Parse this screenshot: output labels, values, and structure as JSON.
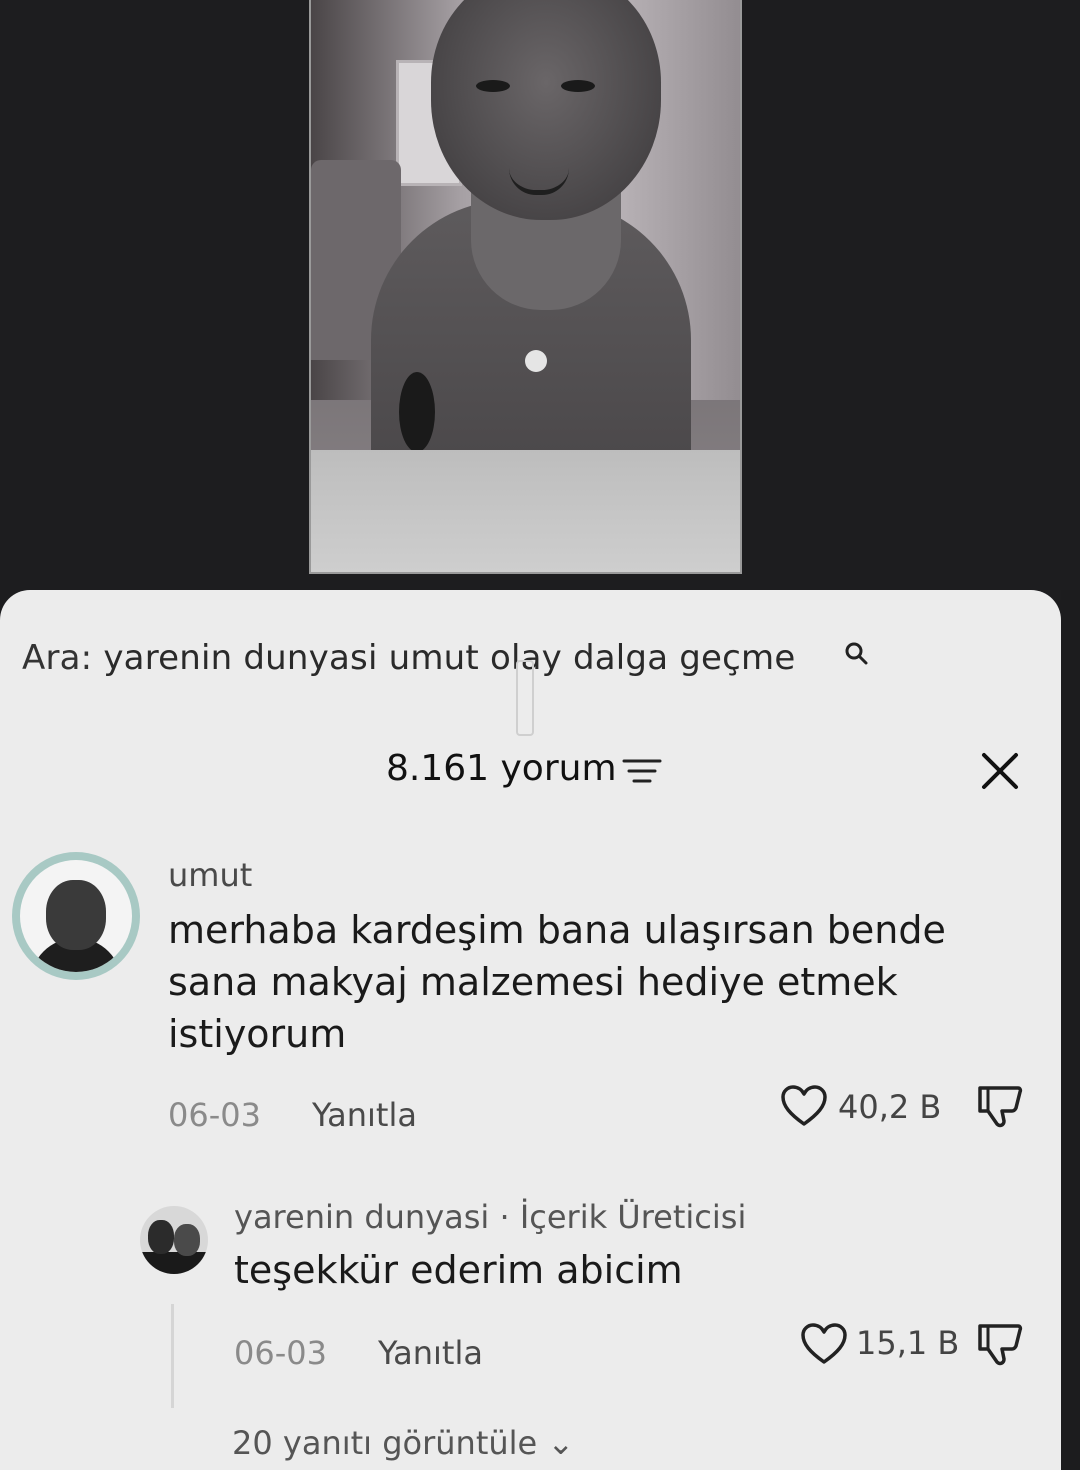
{
  "search": {
    "label": "Ara:",
    "query": "yarenin dunyasi umut olay dalga geçme"
  },
  "comments_header": {
    "count_label": "8.161 yorum"
  },
  "comment": {
    "username": "umut",
    "text": "merhaba kardeşim bana ulaşırsan bende sana makyaj malzemesi hediye etmek istiyorum",
    "date": "06-03",
    "reply_label": "Yanıtla",
    "likes": "40,2 B"
  },
  "reply": {
    "username": "yarenin dunyasi · İçerik Üreticisi",
    "text": "teşekkür ederim abicim",
    "date": "06-03",
    "reply_label": "Yanıtla",
    "likes": "15,1 B"
  },
  "view_replies": "20 yanıtı görüntüle ⌄",
  "icons": {
    "search": "search-icon",
    "filter": "filter-icon",
    "close": "close-icon",
    "like": "heart-icon",
    "dislike": "dislike-icon"
  },
  "colors": {
    "sheet": "#ececec",
    "background": "#1c1c1e",
    "avatar_ring": "#a8c9c4"
  }
}
